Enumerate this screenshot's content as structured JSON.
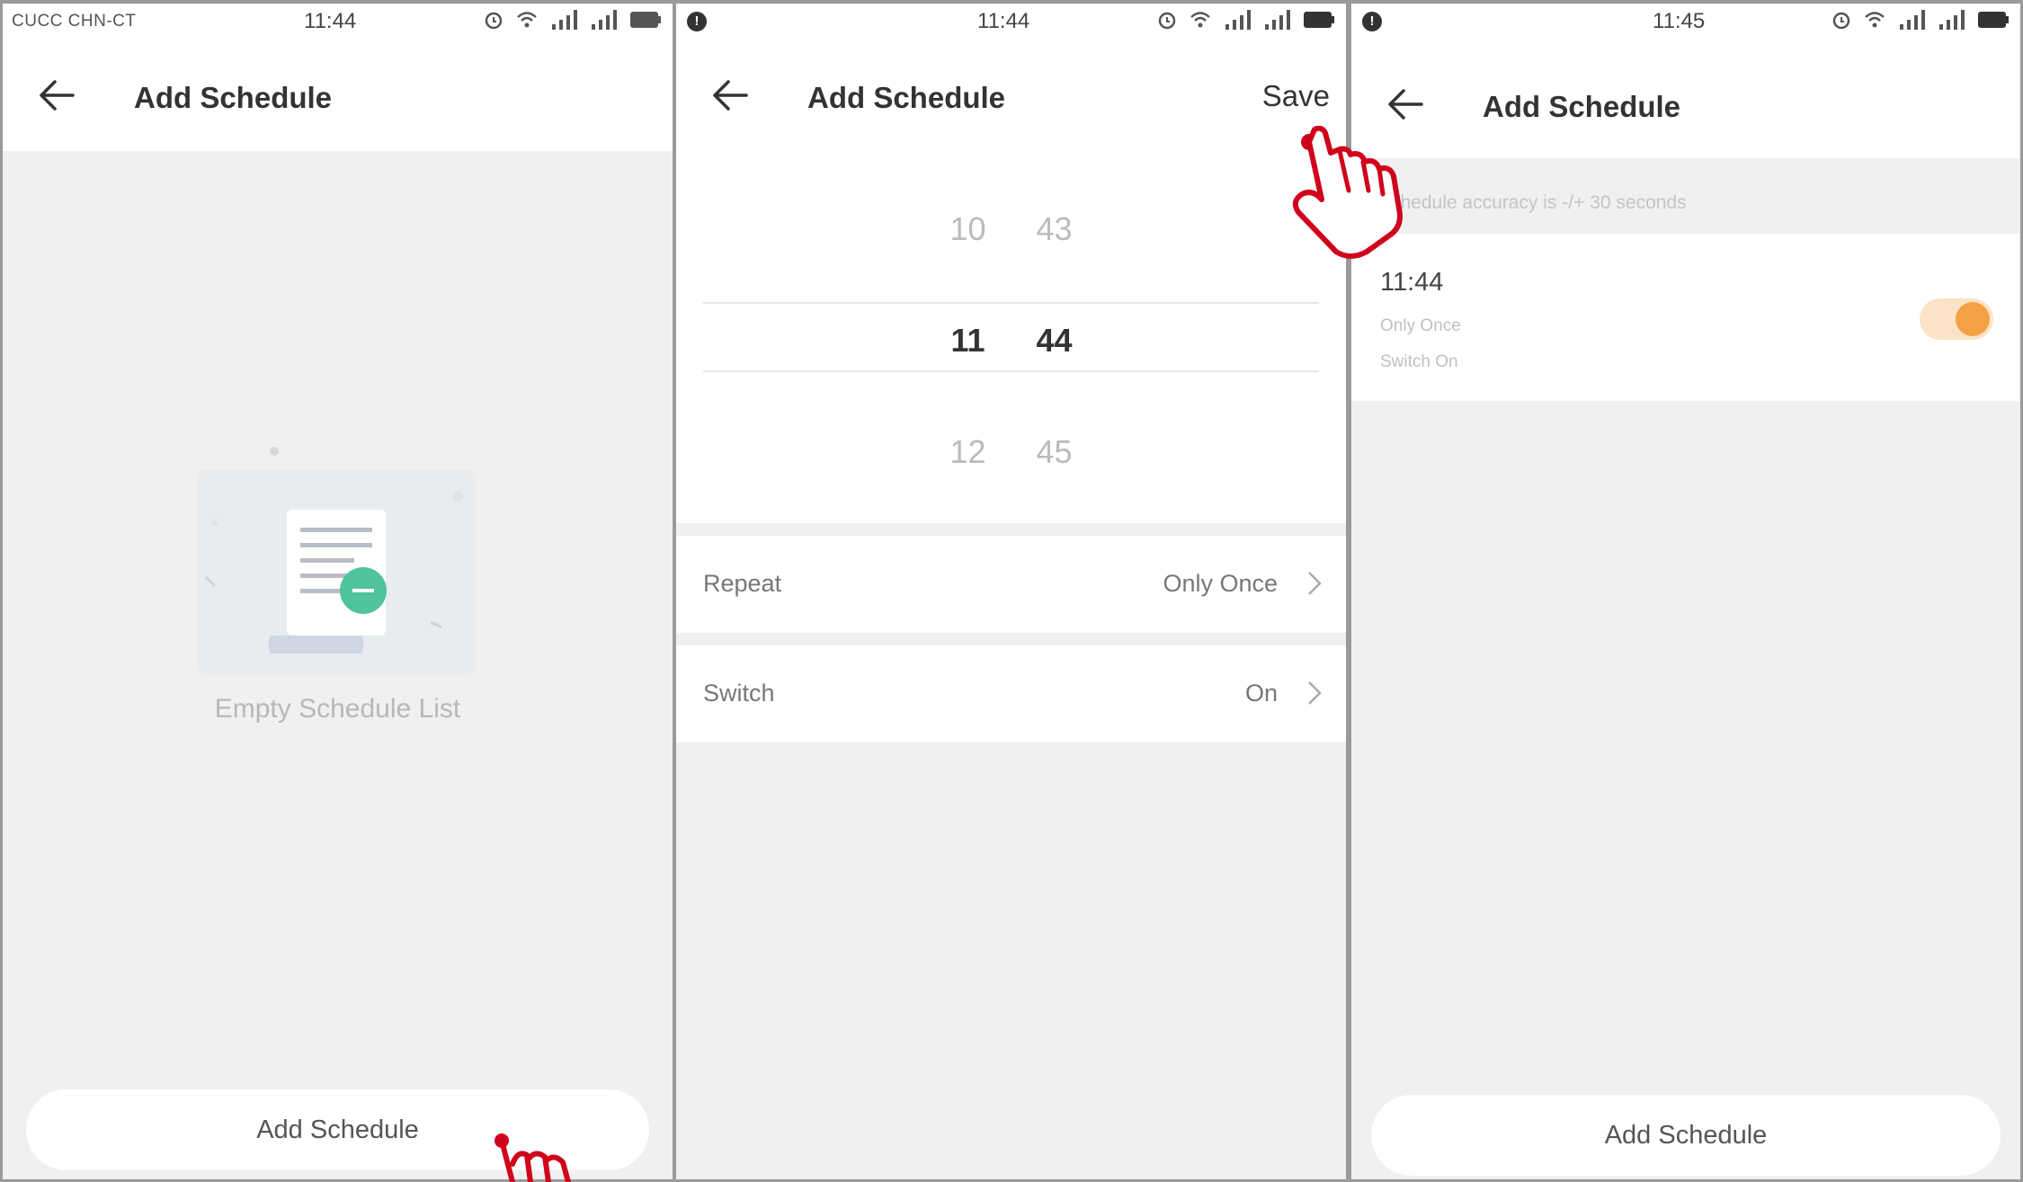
{
  "colors": {
    "hand_outline": "#d0021b",
    "toggle_on": "#f4a146",
    "toggle_track": "#fbe3c8",
    "illustration_accent": "#4fc39a",
    "background": "#f0f0f0"
  },
  "panel1": {
    "status": {
      "carrier": "CUCC CHN-CT",
      "time": "11:44"
    },
    "header": {
      "title": "Add Schedule"
    },
    "empty_text": "Empty Schedule List",
    "bottom_button": "Add Schedule"
  },
  "panel2": {
    "status": {
      "time": "11:44",
      "notification_badge": "!"
    },
    "header": {
      "title": "Add Schedule",
      "save": "Save"
    },
    "picker": {
      "hours": [
        "10",
        "11",
        "12"
      ],
      "minutes": [
        "43",
        "44",
        "45"
      ],
      "selected_hour": "11",
      "selected_minute": "44"
    },
    "repeat": {
      "label": "Repeat",
      "value": "Only Once"
    },
    "switch": {
      "label": "Switch",
      "value": "On"
    }
  },
  "panel3": {
    "status": {
      "time": "11:45",
      "notification_badge": "!"
    },
    "header": {
      "title": "Add Schedule"
    },
    "accuracy_note": "Schedule accuracy is -/+ 30 seconds",
    "schedule": {
      "time": "11:44",
      "repeat": "Only Once",
      "action": "Switch On",
      "enabled": true
    },
    "bottom_button": "Add Schedule"
  },
  "icons": [
    "back-arrow-icon",
    "chevron-right-icon",
    "alarm-icon",
    "wifi-icon",
    "signal-icon",
    "battery-icon",
    "pointing-hand-icon"
  ]
}
